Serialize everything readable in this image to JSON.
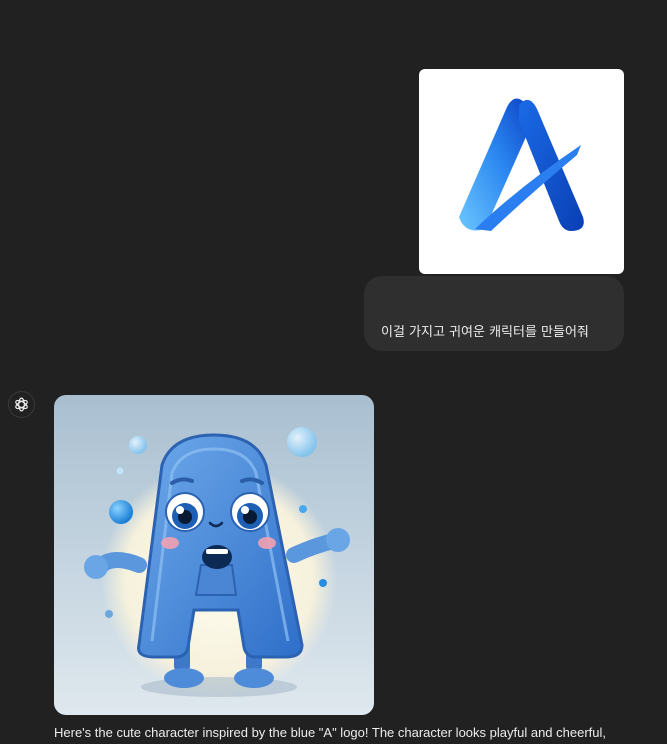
{
  "user_message": {
    "image_alt": "blue A logo",
    "text": "이걸 가지고 귀여운 캐릭터를 만들어줘"
  },
  "assistant": {
    "avatar_icon": "chatgpt-logo-icon",
    "image_alt": "cute blue A character",
    "text": "Here's the cute character inspired by the blue \"A\" logo! The character looks playful and cheerful,"
  },
  "colors": {
    "background": "#212121",
    "user_bubble": "#2f2f2f",
    "logo_blue": "#1a6ae6"
  }
}
